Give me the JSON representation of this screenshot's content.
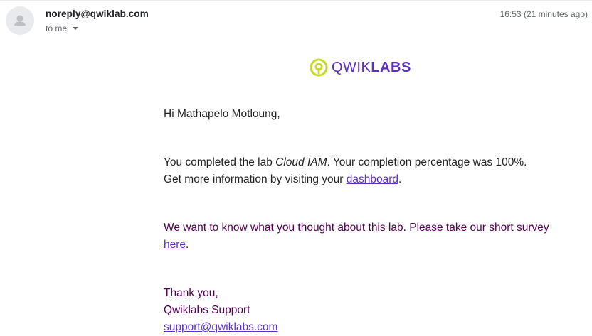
{
  "header": {
    "sender": "noreply@qwiklab.com",
    "recipient_label": "to me",
    "timestamp": "16:53 (21 minutes ago)"
  },
  "logo": {
    "word_part1": "QWIK",
    "word_part2": "LABS",
    "brand_color": "#5c2fc2",
    "mark_color": "#c6d82c"
  },
  "email": {
    "greeting": "Hi Mathapelo Motloung,",
    "completion_prefix": "You completed the lab ",
    "lab_name": "Cloud IAM",
    "completion_suffix": ". Your completion percentage was 100%.",
    "info_prefix": "Get more information by visiting your ",
    "dashboard_link": "dashboard",
    "info_suffix": ".",
    "survey_text": "We want to know what you thought about this lab. Please take our short survey ",
    "survey_link": "here",
    "survey_suffix": ".",
    "thanks": "Thank you,",
    "team": "Qwiklabs Support",
    "support_email": "support@qwiklabs.com"
  }
}
